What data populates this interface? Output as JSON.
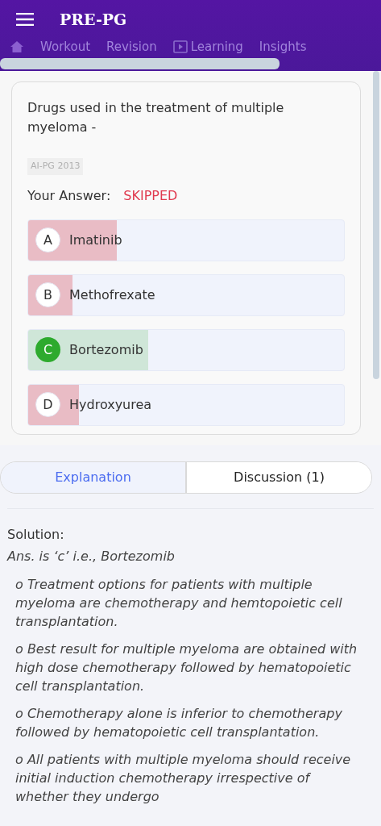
{
  "app_bar": {
    "title": "PRE-PG"
  },
  "nav_tabs": [
    {
      "kind": "home"
    },
    {
      "label": "Workout"
    },
    {
      "label": "Revision"
    },
    {
      "label": "Learning",
      "kind": "video"
    },
    {
      "label": "Insights"
    }
  ],
  "question": {
    "text": "Drugs used in the treatment of multiple myeloma -",
    "tag": "AI-PG 2013",
    "answer_label": "Your Answer:",
    "answer_value": "SKIPPED",
    "options": [
      {
        "letter": "A",
        "text": "Imatinib",
        "correct": false,
        "level": 0.28
      },
      {
        "letter": "B",
        "text": "Methofrexate",
        "correct": false,
        "level": 0.14
      },
      {
        "letter": "C",
        "text": "Bortezomib",
        "correct": true,
        "level": 0.38
      },
      {
        "letter": "D",
        "text": "Hydroxyurea",
        "correct": false,
        "level": 0.16
      }
    ]
  },
  "detail_tabs": [
    {
      "label": "Explanation",
      "selected": true
    },
    {
      "label": "Discussion (1)",
      "selected": false
    }
  ],
  "solution": {
    "heading": "Solution:",
    "answer": "Ans. is ‘c’ i.e., Bortezomib",
    "points": [
      "o Treatment options for patients with multiple myeloma are chemotherapy and hemtopoietic cell transplantation.",
      "o Best result for multiple myeloma are obtained with high dose chemotherapy followed by hematopoietic cell transplantation.",
      "o Chemotherapy alone is inferior to chemotherapy followed by hematopoietic cell transplantation.",
      "o All patients with multiple myeloma should receive initial induction chemotherapy irrespective of whether they undergo"
    ]
  }
}
